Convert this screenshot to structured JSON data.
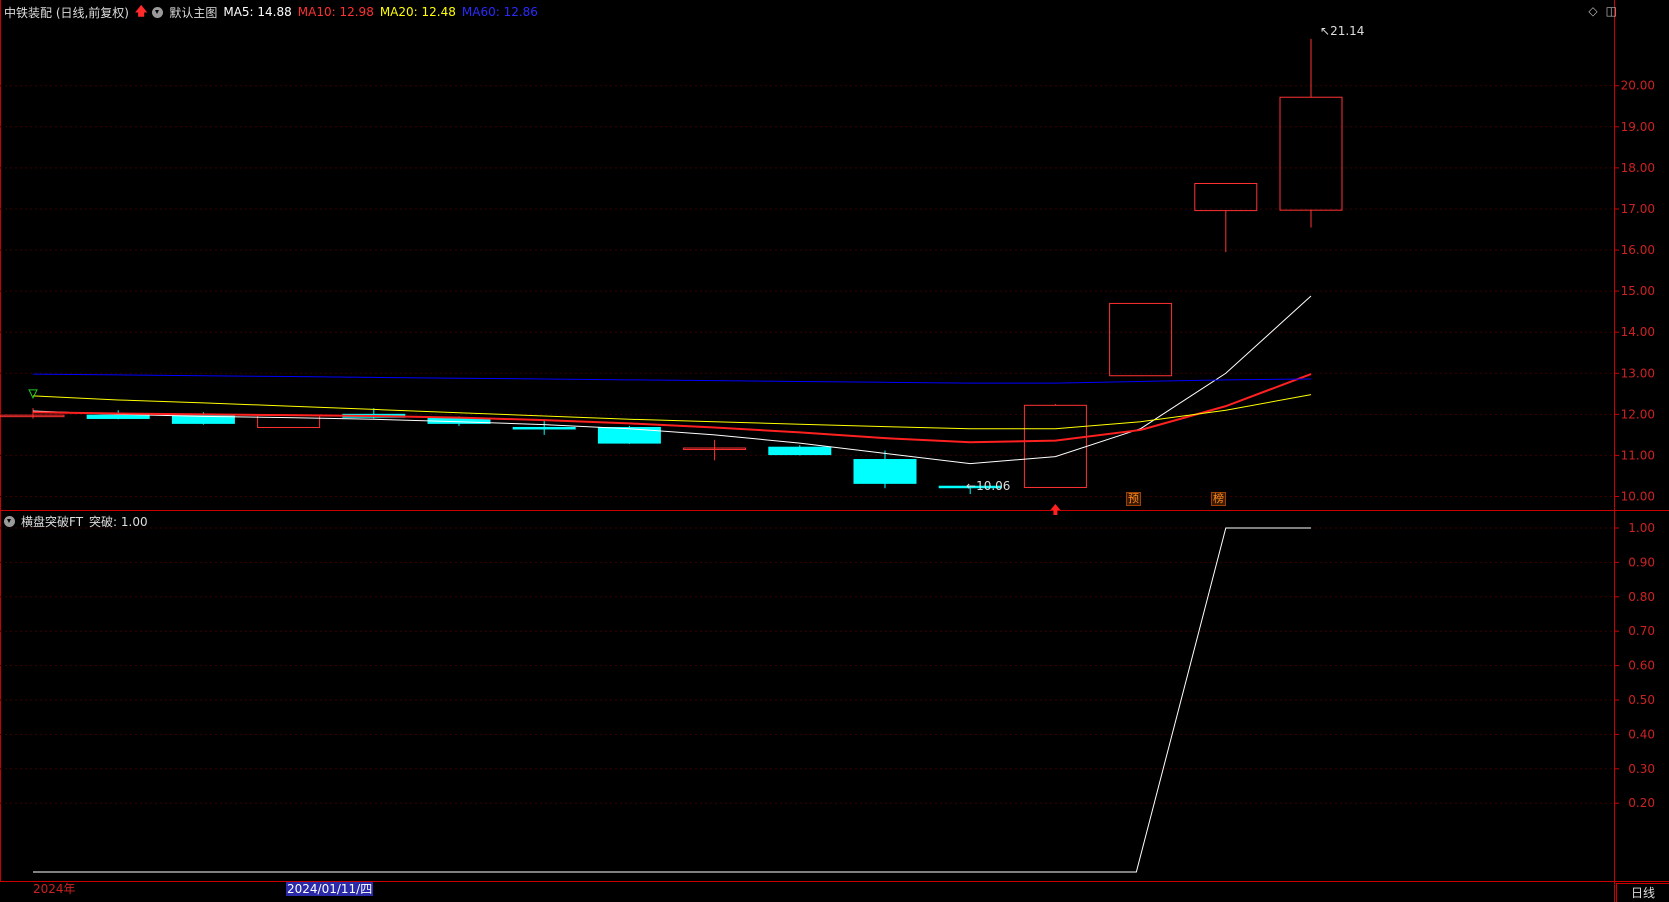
{
  "header": {
    "stock_title": "中铁装配 (日线,前复权)",
    "main_chart_label": "默认主图",
    "ma5_label": "MA5: 14.88",
    "ma10_label": "MA10: 12.98",
    "ma20_label": "MA20: 12.48",
    "ma60_label": "MA60: 12.86"
  },
  "indicator_header": {
    "name": "横盘突破FT",
    "value_label": "突破: 1.00"
  },
  "annotations": {
    "high_label": "21.14",
    "low_label": "10.06",
    "signal_mark_1": "预",
    "signal_mark_2": "榜"
  },
  "x_axis": {
    "year_label": "2024年",
    "cursor_date": "2024/01/11/四"
  },
  "period_button": "日线",
  "colors": {
    "background": "#000000",
    "grid": "#3a0000",
    "axis_border": "#cc0000",
    "up": "#ff3232",
    "down": "#00ffff",
    "ma5": "#ffffff",
    "ma10": "#ff2020",
    "ma20": "#ffff00",
    "ma60": "#0000ff"
  },
  "chart_data": [
    {
      "type": "candlestick",
      "title": "中铁装配 (日线,前复权)",
      "y_ticks": [
        "10.00",
        "11.00",
        "12.00",
        "13.00",
        "14.00",
        "15.00",
        "16.00",
        "17.00",
        "18.00",
        "19.00",
        "20.00"
      ],
      "ylim": [
        9.72,
        21.6
      ],
      "candles": [
        {
          "o": 11.98,
          "h": 12.15,
          "l": 11.9,
          "c": 11.98
        },
        {
          "o": 11.98,
          "h": 12.1,
          "l": 11.88,
          "c": 11.9
        },
        {
          "o": 11.97,
          "h": 12.05,
          "l": 11.75,
          "c": 11.78
        },
        {
          "o": 11.68,
          "h": 11.98,
          "l": 11.68,
          "c": 11.98
        },
        {
          "o": 12.0,
          "h": 12.15,
          "l": 11.9,
          "c": 11.93
        },
        {
          "o": 11.9,
          "h": 11.95,
          "l": 11.72,
          "c": 11.78
        },
        {
          "o": 11.68,
          "h": 11.85,
          "l": 11.5,
          "c": 11.66
        },
        {
          "o": 11.68,
          "h": 11.72,
          "l": 11.28,
          "c": 11.3
        },
        {
          "o": 11.18,
          "h": 11.38,
          "l": 10.88,
          "c": 11.18
        },
        {
          "o": 11.2,
          "h": 11.25,
          "l": 11.0,
          "c": 11.02
        },
        {
          "o": 10.9,
          "h": 11.12,
          "l": 10.2,
          "c": 10.32
        },
        {
          "o": 10.25,
          "h": 10.27,
          "l": 10.06,
          "c": 10.22
        },
        {
          "o": 10.22,
          "h": 12.25,
          "l": 10.22,
          "c": 12.22
        },
        {
          "o": 12.94,
          "h": 14.7,
          "l": 12.94,
          "c": 14.7
        },
        {
          "o": 16.96,
          "h": 17.62,
          "l": 15.95,
          "c": 17.62
        },
        {
          "o": 16.97,
          "h": 21.14,
          "l": 16.55,
          "c": 19.72
        }
      ],
      "series": [
        {
          "name": "MA5",
          "values": [
            12.08,
            12.0,
            11.95,
            11.92,
            11.88,
            11.82,
            11.75,
            11.65,
            11.5,
            11.3,
            11.05,
            10.8,
            10.97,
            11.65,
            13.0,
            14.88
          ]
        },
        {
          "name": "MA10",
          "values": [
            12.05,
            12.02,
            12.0,
            11.98,
            11.96,
            11.92,
            11.86,
            11.78,
            11.68,
            11.56,
            11.42,
            11.32,
            11.36,
            11.62,
            12.2,
            12.98
          ]
        },
        {
          "name": "MA20",
          "values": [
            12.45,
            12.35,
            12.28,
            12.2,
            12.12,
            12.04,
            11.96,
            11.88,
            11.82,
            11.76,
            11.7,
            11.65,
            11.65,
            11.82,
            12.1,
            12.48
          ]
        },
        {
          "name": "MA60",
          "values": [
            12.98,
            12.96,
            12.94,
            12.92,
            12.9,
            12.88,
            12.86,
            12.84,
            12.82,
            12.8,
            12.78,
            12.76,
            12.76,
            12.8,
            12.84,
            12.86
          ]
        }
      ]
    },
    {
      "type": "line",
      "title": "横盘突破FT",
      "y_ticks": [
        "0.20",
        "0.30",
        "0.40",
        "0.50",
        "0.60",
        "0.70",
        "0.80",
        "0.90",
        "1.00"
      ],
      "ylim": [
        -0.0,
        1.0
      ],
      "series": [
        {
          "name": "突破",
          "values": [
            0,
            0,
            0,
            0,
            0,
            0,
            0,
            0,
            0,
            0,
            0,
            0,
            0,
            0,
            1,
            1
          ]
        }
      ]
    }
  ]
}
